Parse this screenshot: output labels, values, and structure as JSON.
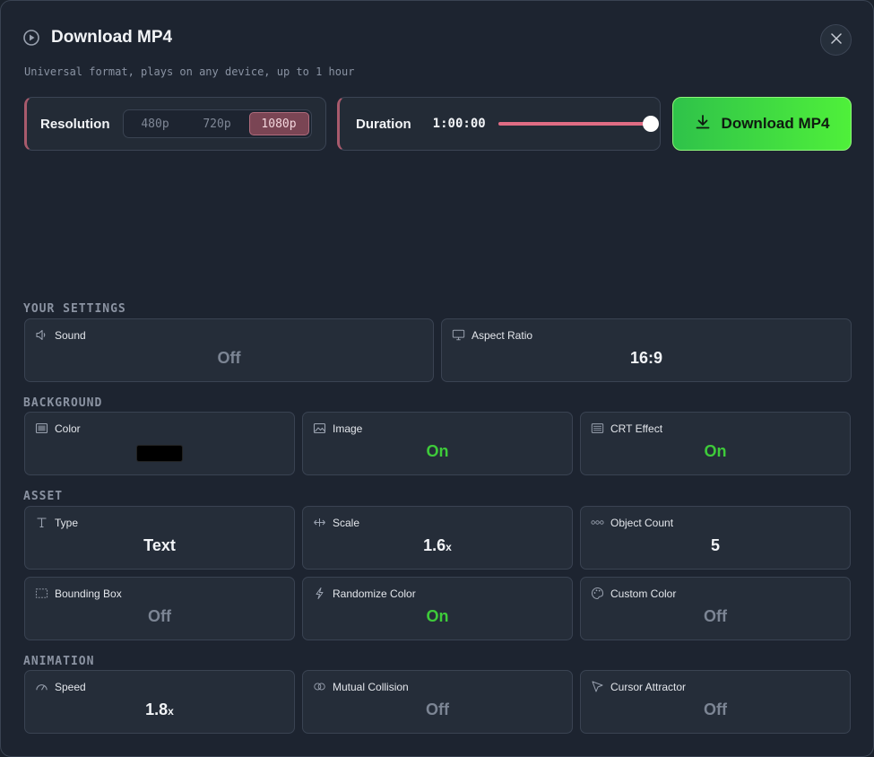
{
  "dialog": {
    "title": "Download MP4",
    "subtitle": "Universal format, plays on any device, up to 1 hour",
    "icon": "play-circle-icon",
    "close_icon": "close-icon"
  },
  "resolution": {
    "label": "Resolution",
    "options": [
      "480p",
      "720p",
      "1080p"
    ],
    "selected": "1080p"
  },
  "duration": {
    "label": "Duration",
    "value": "1:00:00",
    "slider_fraction": 1.0
  },
  "download_button": {
    "label": "Download MP4",
    "icon": "download-icon"
  },
  "sections": {
    "your_settings": "YOUR SETTINGS",
    "background": "BACKGROUND",
    "asset": "ASSET",
    "animation": "ANIMATION"
  },
  "your_settings": [
    {
      "label": "Sound",
      "value": "Off",
      "icon": "speaker-icon"
    },
    {
      "label": "Aspect Ratio",
      "value": "16:9",
      "icon": "monitor-icon"
    }
  ],
  "background": [
    {
      "label": "Color",
      "value": "#000000",
      "icon": "color-square-icon"
    },
    {
      "label": "Image",
      "value": "On",
      "icon": "image-icon"
    },
    {
      "label": "CRT Effect",
      "value": "On",
      "icon": "scanlines-icon"
    }
  ],
  "asset": [
    {
      "label": "Type",
      "value": "Text",
      "icon": "text-cursor-icon"
    },
    {
      "label": "Scale",
      "value": "1.6",
      "suffix": "x",
      "icon": "scale-arrows-icon"
    },
    {
      "label": "Object Count",
      "value": "5",
      "icon": "dots-icon"
    },
    {
      "label": "Bounding Box",
      "value": "Off",
      "icon": "dashed-box-icon"
    },
    {
      "label": "Randomize Color",
      "value": "On",
      "icon": "lightning-icon"
    },
    {
      "label": "Custom Color",
      "value": "Off",
      "icon": "palette-icon"
    }
  ],
  "animation": [
    {
      "label": "Speed",
      "value": "1.8",
      "suffix": "x",
      "icon": "gauge-icon"
    },
    {
      "label": "Mutual Collision",
      "value": "Off",
      "icon": "collision-icon"
    },
    {
      "label": "Cursor Attractor",
      "value": "Off",
      "icon": "cursor-icon"
    }
  ],
  "colors": {
    "accent": "#e06c84",
    "on": "#3ecb3a",
    "off": "#7c8594",
    "download": "#4ff03a"
  }
}
